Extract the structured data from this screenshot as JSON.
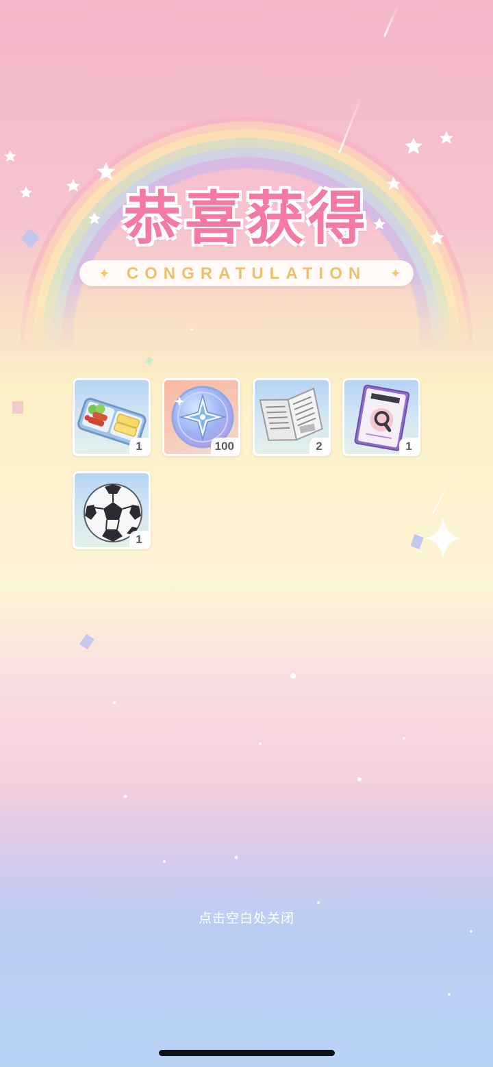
{
  "header": {
    "title": "恭喜获得",
    "subtitle": "CONGRATULATION"
  },
  "rewards": [
    {
      "name": "bento-box-icon",
      "count": "1"
    },
    {
      "name": "compass-coin-icon",
      "count": "100"
    },
    {
      "name": "newspaper-icon",
      "count": "2"
    },
    {
      "name": "magnifier-book-icon",
      "count": "1"
    },
    {
      "name": "soccer-ball-icon",
      "count": "1"
    }
  ],
  "footer": {
    "close_hint": "点击空白处关闭"
  },
  "colors": {
    "title_pink": "#f27aa3",
    "subtitle_gold": "#e9c16a",
    "count_text": "#5d5a66"
  }
}
